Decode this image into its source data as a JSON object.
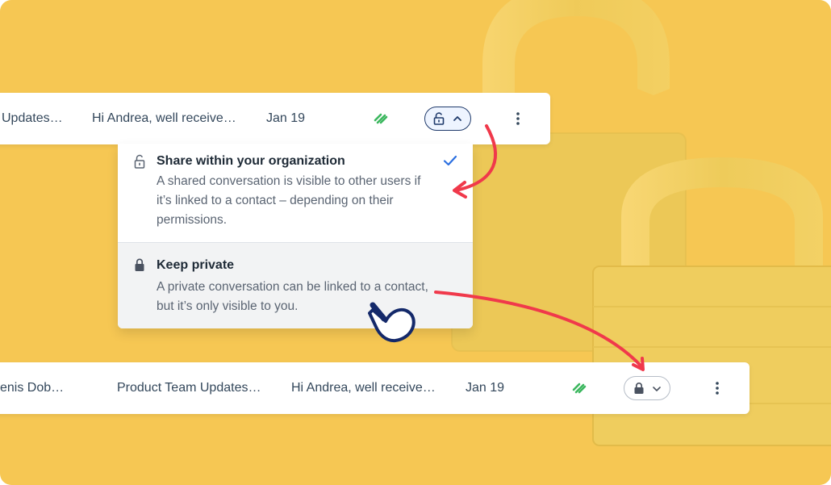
{
  "colors": {
    "background": "#f6c753",
    "accent_blue": "#1f3a6b",
    "check_blue": "#2b6fe0",
    "sync_green": "#3bb75e",
    "arrow_red": "#f0394b"
  },
  "top_row": {
    "subject": "Updates…",
    "preview": "Hi Andrea, well receive…",
    "date": "Jan 19",
    "visibility": "shared"
  },
  "menu": {
    "options": [
      {
        "title": "Share within your organization",
        "description": "A shared conversation is visible to other users if it’s linked to a contact – depending on their permissions.",
        "icon": "unlocked-padlock-icon",
        "selected": true
      },
      {
        "title": "Keep private",
        "description": "A private conversation can be linked to a contact, but it’s only visible to you.",
        "icon": "locked-padlock-icon",
        "selected": false
      }
    ]
  },
  "bottom_row": {
    "sender": "enis Dob…",
    "subject": "Product Team Updates…",
    "preview": "Hi Andrea, well receive…",
    "date": "Jan 19",
    "visibility": "private"
  }
}
